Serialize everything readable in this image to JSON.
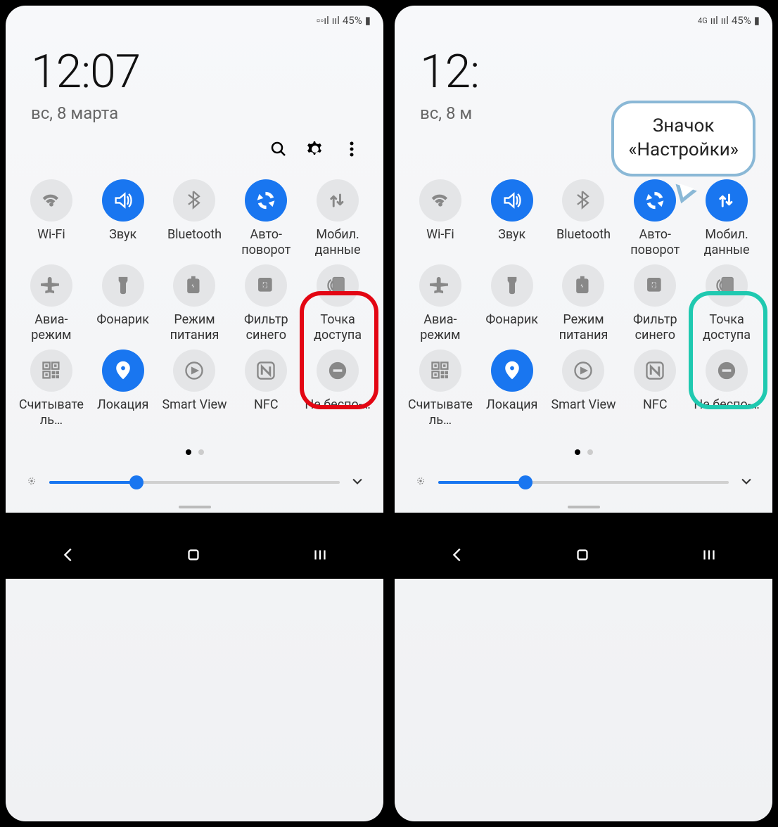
{
  "left": {
    "status": {
      "net4g": false,
      "battery_text": "45%"
    },
    "clock": {
      "time": "12:07",
      "date": "вс, 8 марта"
    },
    "tiles": [
      {
        "label": "Wi-Fi",
        "icon": "wifi",
        "on": false
      },
      {
        "label": "Звук",
        "icon": "sound",
        "on": true
      },
      {
        "label": "Bluetooth",
        "icon": "bluetooth",
        "on": false
      },
      {
        "label": "Авто-поворот",
        "icon": "rotate",
        "on": true
      },
      {
        "label": "Мобил. данные",
        "icon": "data",
        "on": false
      },
      {
        "label": "Авиа-режим",
        "icon": "airplane",
        "on": false
      },
      {
        "label": "Фонарик",
        "icon": "flashlight",
        "on": false
      },
      {
        "label": "Режим питания",
        "icon": "battery",
        "on": false
      },
      {
        "label": "Фильтр синего",
        "icon": "bluefilter",
        "on": false
      },
      {
        "label": "Точка доступа",
        "icon": "hotspot",
        "on": false
      },
      {
        "label": "Считыватель…",
        "icon": "qr",
        "on": false
      },
      {
        "label": "Локация",
        "icon": "location",
        "on": true
      },
      {
        "label": "Smart View",
        "icon": "smartview",
        "on": false
      },
      {
        "label": "NFC",
        "icon": "nfc",
        "on": false
      },
      {
        "label": "Не беспо-…",
        "icon": "dnd",
        "on": false
      }
    ],
    "brightness": 30,
    "highlight": {
      "type": "red-box-tile",
      "tile_index": 4
    }
  },
  "right": {
    "status": {
      "net4g": true,
      "battery_text": "45%"
    },
    "clock": {
      "time": "12:",
      "date": "вс, 8 м"
    },
    "tiles": [
      {
        "label": "Wi-Fi",
        "icon": "wifi",
        "on": false
      },
      {
        "label": "Звук",
        "icon": "sound",
        "on": true
      },
      {
        "label": "Bluetooth",
        "icon": "bluetooth",
        "on": false
      },
      {
        "label": "Авто-поворот",
        "icon": "rotate",
        "on": true
      },
      {
        "label": "Мобил. данные",
        "icon": "data",
        "on": true
      },
      {
        "label": "Авиа-режим",
        "icon": "airplane",
        "on": false
      },
      {
        "label": "Фонарик",
        "icon": "flashlight",
        "on": false
      },
      {
        "label": "Режим питания",
        "icon": "battery",
        "on": false
      },
      {
        "label": "Фильтр синего",
        "icon": "bluefilter",
        "on": false
      },
      {
        "label": "Точка доступа",
        "icon": "hotspot",
        "on": false
      },
      {
        "label": "Считыватель…",
        "icon": "qr",
        "on": false
      },
      {
        "label": "Локация",
        "icon": "location",
        "on": true
      },
      {
        "label": "Smart View",
        "icon": "smartview",
        "on": false
      },
      {
        "label": "NFC",
        "icon": "nfc",
        "on": false
      },
      {
        "label": "Не беспо-…",
        "icon": "dnd",
        "on": false
      }
    ],
    "brightness": 30,
    "highlight": {
      "type": "teal-box-tile",
      "tile_index": 4,
      "ring_on_gear": true
    },
    "callout": {
      "line1": "Значок",
      "line2": "«Настройки»"
    }
  }
}
